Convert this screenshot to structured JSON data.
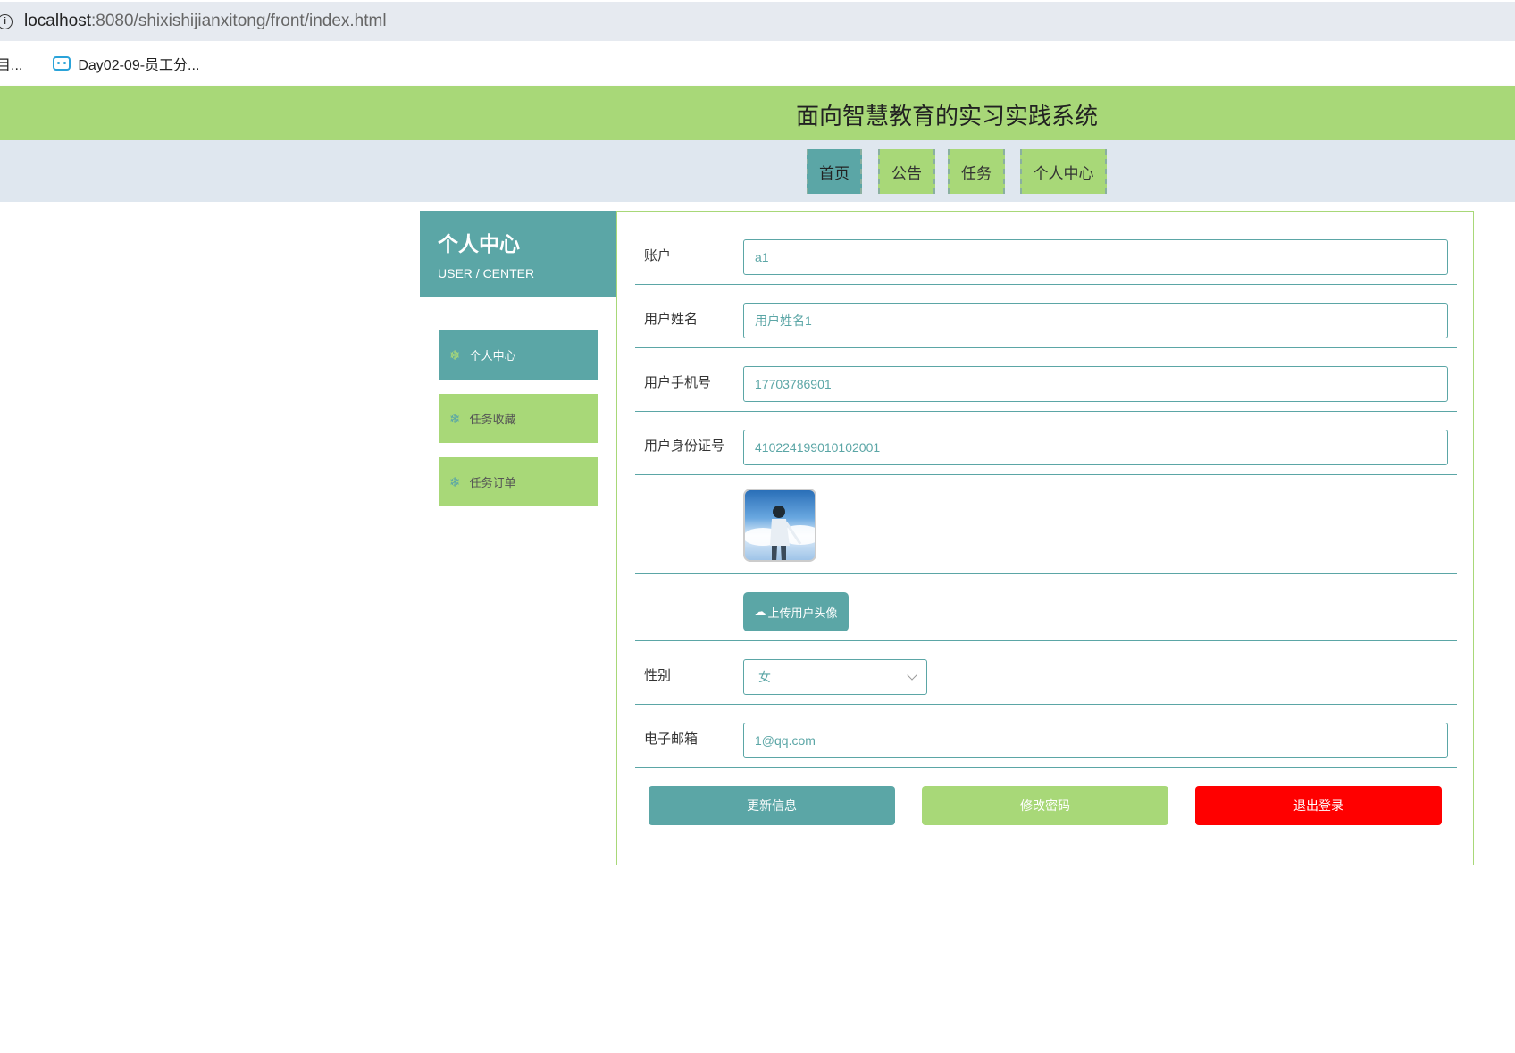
{
  "browser": {
    "url_host": "localhost",
    "url_rest": ":8080/shixishijianxitong/front/index.html",
    "bookmarks": [
      "目...",
      "Day02-09-员工分..."
    ]
  },
  "site": {
    "title": "面向智慧教育的实习实践系统",
    "nav": [
      "首页",
      "公告",
      "任务",
      "个人中心"
    ],
    "active_nav": "首页"
  },
  "sidebar": {
    "title": "个人中心",
    "subtitle": "USER / CENTER",
    "items": [
      {
        "label": "个人中心",
        "active": true
      },
      {
        "label": "任务收藏",
        "active": false
      },
      {
        "label": "任务订单",
        "active": false
      }
    ]
  },
  "form": {
    "fields": [
      {
        "label": "账户",
        "value": "a1"
      },
      {
        "label": "用户姓名",
        "value": "用户姓名1"
      },
      {
        "label": "用户手机号",
        "value": "17703786901"
      },
      {
        "label": "用户身份证号",
        "value": "410224199010102001"
      }
    ],
    "upload_label": "上传用户头像",
    "gender_label": "性别",
    "gender_value": "女",
    "email_label": "电子邮箱",
    "email_value": "1@qq.com",
    "buttons": {
      "update": "更新信息",
      "change_password": "修改密码",
      "logout": "退出登录"
    }
  },
  "colors": {
    "green": "#a8d878",
    "teal": "#5ba6a6",
    "red": "#ff0000"
  }
}
